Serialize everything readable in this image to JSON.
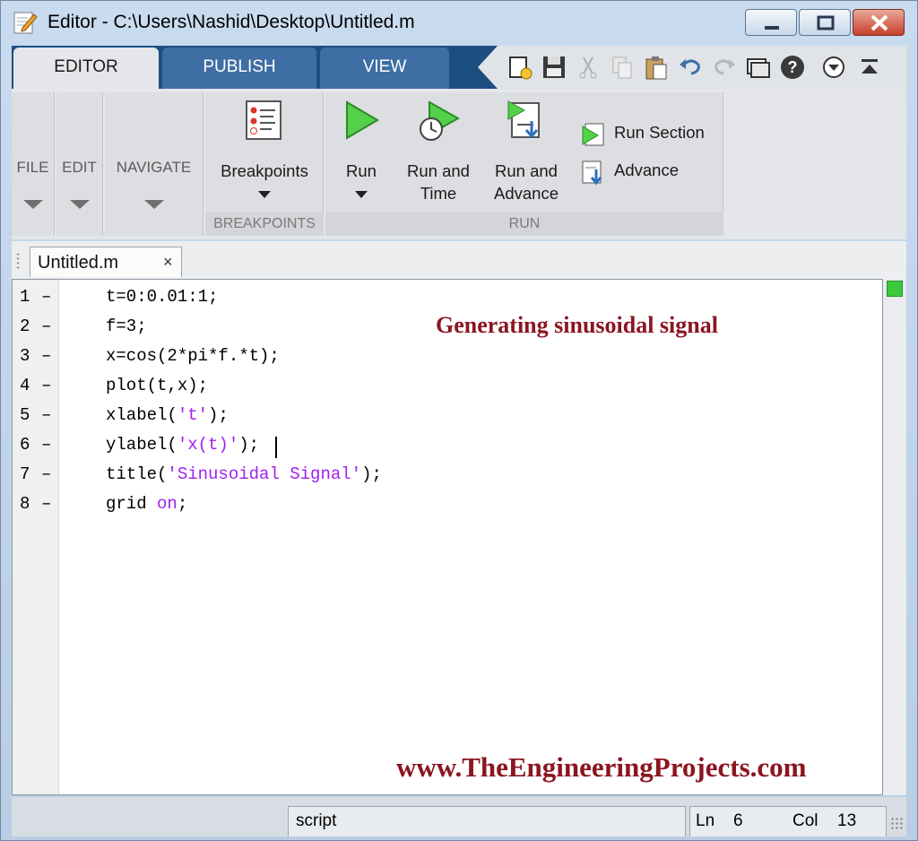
{
  "window": {
    "title": "Editor - C:\\Users\\Nashid\\Desktop\\Untitled.m",
    "icons": {
      "app": "editor-pencil-icon",
      "minimize": "minimize-icon",
      "maximize": "maximize-icon",
      "close": "close-icon"
    }
  },
  "tabs": [
    {
      "label": "EDITOR",
      "active": true
    },
    {
      "label": "PUBLISH",
      "active": false
    },
    {
      "label": "VIEW",
      "active": false
    }
  ],
  "quick_access": [
    "new-icon",
    "save-icon",
    "cut-icon",
    "copy-icon",
    "paste-icon",
    "undo-icon",
    "redo-icon",
    "switch-windows-icon",
    "help-icon",
    "options-icon",
    "minimize-toolstrip-icon"
  ],
  "ribbon": {
    "collapsed": [
      {
        "label": "FILE"
      },
      {
        "label": "EDIT"
      },
      {
        "label": "NAVIGATE"
      }
    ],
    "breakpoints": {
      "button_label": "Breakpoints",
      "group_label": "BREAKPOINTS"
    },
    "run": {
      "run_label": "Run",
      "run_and_time": [
        "Run and",
        "Time"
      ],
      "run_and_advance": [
        "Run and",
        "Advance"
      ],
      "run_section": "Run Section",
      "advance": "Advance",
      "group_label": "RUN"
    }
  },
  "document": {
    "tab_name": "Untitled.m",
    "close_glyph": "×"
  },
  "code": {
    "lines": [
      {
        "num": "1",
        "dash": "–",
        "text": "t=0:0.01:1;"
      },
      {
        "num": "2",
        "dash": "–",
        "text": "f=3;"
      },
      {
        "num": "3",
        "dash": "–",
        "text": "x=cos(2*pi*f.*t);"
      },
      {
        "num": "4",
        "dash": "–",
        "text": "plot(t,x);"
      },
      {
        "num": "5",
        "dash": "–",
        "pre": "xlabel(",
        "str": "'t'",
        "post": ");"
      },
      {
        "num": "6",
        "dash": "–",
        "pre": "ylabel(",
        "str": "'x(t)'",
        "post": ");"
      },
      {
        "num": "7",
        "dash": "–",
        "pre": "title(",
        "str": "'Sinusoidal Signal'",
        "post": ");"
      },
      {
        "num": "8",
        "dash": "–",
        "pre": "grid ",
        "str": "on",
        "post": ";"
      }
    ],
    "string_color": "#a020f0"
  },
  "annotations": {
    "heading": "Generating sinusoidal signal",
    "watermark": "www.TheEngineeringProjects.com",
    "color": "#8b1520"
  },
  "status": {
    "mode": "script",
    "ln_label": "Ln",
    "ln_value": "6",
    "col_label": "Col",
    "col_value": "13"
  },
  "colors": {
    "tab_strip": "#1d4e82",
    "active_tab": "#e4e6e9",
    "ribbon": "#e4e6e9",
    "run_green": "#3cc83c"
  }
}
